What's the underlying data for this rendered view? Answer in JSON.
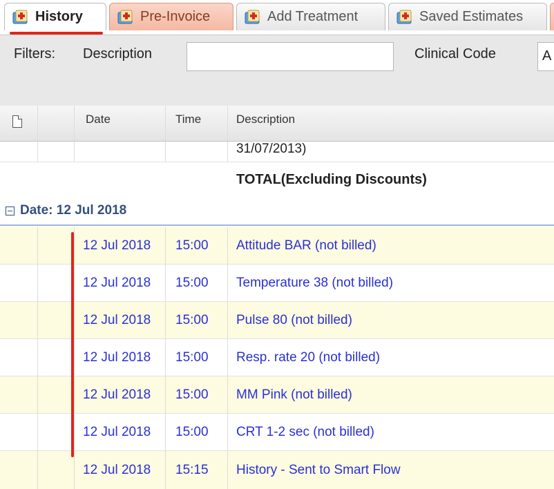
{
  "tabs": [
    {
      "label": "History",
      "icon": "medical-folder-icon"
    },
    {
      "label": "Pre-Invoice",
      "icon": "medical-folder-icon"
    },
    {
      "label": "Add Treatment",
      "icon": "medical-folder-icon"
    },
    {
      "label": "Saved Estimates",
      "icon": "medical-folder-icon"
    }
  ],
  "filters": {
    "label": "Filters:",
    "description_label": "Description",
    "description_value": "",
    "clinical_code_label": "Clinical Code",
    "clinical_code_value": "A"
  },
  "columns": {
    "date": "Date",
    "time": "Time",
    "description": "Description"
  },
  "pre_rows": {
    "partial_text": "31/07/2013)",
    "total_label": "TOTAL(Excluding Discounts)"
  },
  "group": {
    "label": "Date: 12 Jul 2018"
  },
  "rows": [
    {
      "date": "12 Jul 2018",
      "time": "15:00",
      "description": "Attitude BAR (not billed)"
    },
    {
      "date": "12 Jul 2018",
      "time": "15:00",
      "description": "Temperature 38 (not billed)"
    },
    {
      "date": "12 Jul 2018",
      "time": "15:00",
      "description": "Pulse 80 (not billed)"
    },
    {
      "date": "12 Jul 2018",
      "time": "15:00",
      "description": "Resp. rate 20 (not billed)"
    },
    {
      "date": "12 Jul 2018",
      "time": "15:00",
      "description": "MM Pink (not billed)"
    },
    {
      "date": "12 Jul 2018",
      "time": "15:00",
      "description": "CRT 1-2 sec (not billed)"
    },
    {
      "date": "12 Jul 2018",
      "time": "15:15",
      "description": "History - Sent to Smart Flow"
    }
  ],
  "colors": {
    "accent_red": "#e0261b",
    "link_blue": "#2a30d4",
    "group_blue": "#34507c",
    "row_yellow": "#fdfbe0"
  }
}
